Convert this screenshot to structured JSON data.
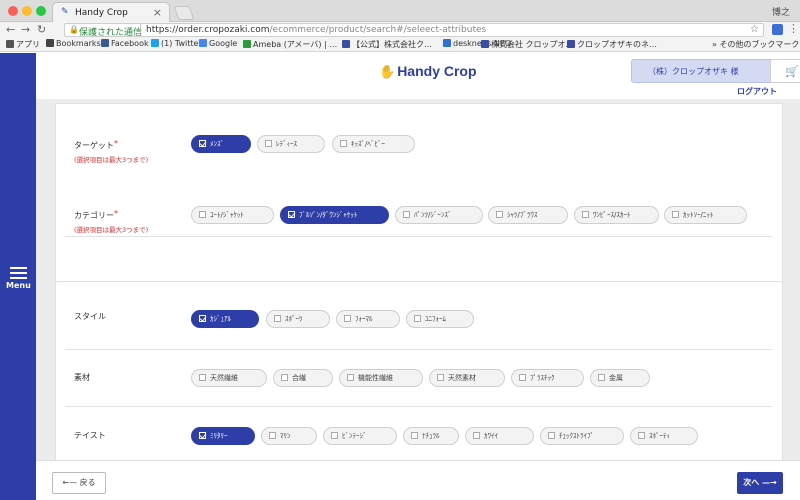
{
  "browser": {
    "tab_title": "Handy Crop",
    "user": "博之",
    "secure_label": "保護された通信",
    "url_host": "https://order.cropozaki.com",
    "url_path": "/ecommerce/product/search#/seleect-attributes",
    "bookmarks": [
      {
        "label": "アプリ",
        "color": "#555"
      },
      {
        "label": "Bookmarks",
        "color": "#444"
      },
      {
        "label": "Facebook",
        "color": "#3b5998"
      },
      {
        "label": "(1) Twitter",
        "color": "#1da1f2"
      },
      {
        "label": "Google",
        "color": "#4285f4"
      },
      {
        "label": "Ameba (アメーバ) | …",
        "color": "#2a9d3a"
      },
      {
        "label": "【公式】株式会社ク…",
        "color": "#3b4ca8"
      },
      {
        "label": "desknet's NEO",
        "color": "#2f6fd8"
      },
      {
        "label": "株式会社 クロップオ…",
        "color": "#3b4ca8"
      },
      {
        "label": "クロップオザキのネ…",
        "color": "#3b4ca8"
      }
    ],
    "other_bookmarks": "その他のブックマーク"
  },
  "header": {
    "logo_text": "Handy Crop",
    "company": "（株）クロップオザキ 様",
    "cart_count": "0",
    "logout": "ログアウト"
  },
  "side_menu": {
    "label": "Menu"
  },
  "filters": {
    "target": {
      "label": "ターゲット",
      "note": "(選択項目は最大3つまで)",
      "options": [
        {
          "label": "ﾒﾝｽﾞ",
          "selected": true
        },
        {
          "label": "ﾚﾃﾞｨｰｽ",
          "selected": false
        },
        {
          "label": "ｷｯｽﾞ/ﾍﾞﾋﾞｰ",
          "selected": false
        }
      ]
    },
    "category": {
      "label": "カテゴリー",
      "note": "(選択項目は最大3つまで)",
      "options": [
        {
          "label": "ｺｰﾄ/ｼﾞｬｹｯﾄ",
          "selected": false
        },
        {
          "label": "ﾌﾞﾙｿﾞﾝ/ﾀﾞｳﾝｼﾞｬｹｯﾄ",
          "selected": true
        },
        {
          "label": "ﾊﾟﾝﾂ/ｼﾞｰﾝｽﾞ",
          "selected": false
        },
        {
          "label": "ｼｬﾂ/ﾌﾞﾗｳｽ",
          "selected": false
        },
        {
          "label": "ﾜﾝﾋﾟｰｽ/ｽｶｰﾄ",
          "selected": false
        },
        {
          "label": "ｶｯﾄｿｰ/ﾆｯﾄ",
          "selected": false
        }
      ]
    },
    "style": {
      "label": "スタイル",
      "options": [
        {
          "label": "ｶｼﾞｭｱﾙ",
          "selected": true
        },
        {
          "label": "ｽﾎﾟｰﾂ",
          "selected": false
        },
        {
          "label": "ﾌｫｰﾏﾙ",
          "selected": false
        },
        {
          "label": "ﾕﾆﾌｫｰﾑ",
          "selected": false
        }
      ]
    },
    "material": {
      "label": "素材",
      "options": [
        {
          "label": "天然繊維",
          "selected": false
        },
        {
          "label": "合繊",
          "selected": false
        },
        {
          "label": "機能性繊維",
          "selected": false
        },
        {
          "label": "天然素材",
          "selected": false
        },
        {
          "label": "ﾌﾟﾗｽﾁｯｸ",
          "selected": false
        },
        {
          "label": "金属",
          "selected": false
        }
      ]
    },
    "taste": {
      "label": "テイスト",
      "options": [
        {
          "label": "ﾐﾘﾀﾘｰ",
          "selected": true
        },
        {
          "label": "ﾏﾘﾝ",
          "selected": false
        },
        {
          "label": "ﾋﾞﾝﾃｰｼﾞ",
          "selected": false
        },
        {
          "label": "ﾅﾁｭﾗﾙ",
          "selected": false
        },
        {
          "label": "ｶﾜｲｲ",
          "selected": false
        },
        {
          "label": "ﾁｪｯｸｽﾄﾗｲﾌﾟ",
          "selected": false
        },
        {
          "label": "ｽﾎﾟｰﾃｨ",
          "selected": false
        }
      ]
    }
  },
  "footer": {
    "back_label": "戻る",
    "next_label": "次へ"
  },
  "colors": {
    "primary": "#2e3ea8",
    "required": "#e02e2e",
    "chip_bg": "#f3f3f3"
  }
}
